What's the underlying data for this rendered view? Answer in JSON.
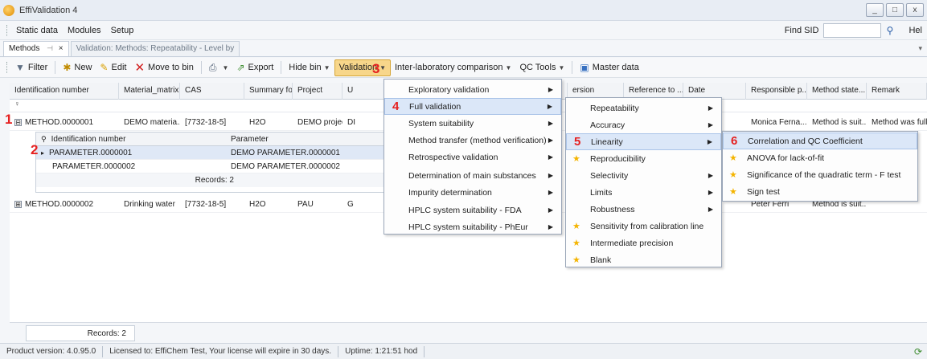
{
  "window": {
    "title": "EffiValidation 4",
    "min": "_",
    "max": "□",
    "close": "x"
  },
  "menubar": {
    "items": [
      "Static data",
      "Modules",
      "Setup"
    ],
    "find_label": "Find SID",
    "find_value": "",
    "help": "Hel"
  },
  "tabs": [
    {
      "label": "Methods",
      "pin": "⊣",
      "close": "×"
    },
    {
      "label": "Validation: Methods: Repeatability - Level by"
    }
  ],
  "toolbar": {
    "filter": "Filter",
    "new": "New",
    "edit": "Edit",
    "move_to_bin": "Move to bin",
    "export": "Export",
    "hide_bin": "Hide bin",
    "validation": "Validation",
    "inter_lab": "Inter-laboratory comparison",
    "qc_tools": "QC Tools",
    "master_data": "Master data"
  },
  "grid": {
    "headers": [
      "Identification number",
      "Material_matrix",
      "CAS",
      "Summary for...",
      "Project",
      "U",
      "ersion",
      "Reference to ...",
      "Date",
      "Responsible p...",
      "Method state...",
      "Remark"
    ],
    "rows": [
      {
        "id": "METHOD.0000001",
        "material": "DEMO materia...",
        "cas": "[7732-18-5]",
        "summary": "H2O",
        "project": "DEMO project",
        "u": "DI",
        "responsible": "Monica Ferna...",
        "state": "Method is suit...",
        "remark": "Method was full...",
        "expand": "⊟"
      },
      {
        "id": "METHOD.0000002",
        "material": "Drinking water",
        "cas": "[7732-18-5]",
        "summary": "H2O",
        "project": "PAU",
        "u": "G",
        "responsible": "Peter Ferri",
        "state": "Method is suit...",
        "remark": "",
        "expand": "⊞"
      }
    ],
    "detail": {
      "headers": [
        "Identification number",
        "Parameter"
      ],
      "rows": [
        {
          "id": "PARAMETER.0000001",
          "param": "DEMO PARAMETER.0000001"
        },
        {
          "id": "PARAMETER.0000002",
          "param": "DEMO PARAMETER.0000002"
        }
      ],
      "records": "Records: 2"
    },
    "records": "Records: 2"
  },
  "validation_menu": [
    "Exploratory validation",
    "Full validation",
    "System suitability",
    "Method transfer (method verification)",
    "Retrospective validation",
    "Determination of main substances",
    "Impurity determination",
    "HPLC system suitability - FDA",
    "HPLC system suitability - PhEur"
  ],
  "full_validation_menu": [
    "Repeatability",
    "Accuracy",
    "Linearity",
    "Reproducibility",
    "Selectivity",
    "Limits",
    "Robustness",
    "Sensitivity from calibration line",
    "Intermediate precision",
    "Blank"
  ],
  "linearity_menu": [
    "Correlation and QC Coefficient",
    "ANOVA for lack-of-fit",
    "Significance of the quadratic term - F test",
    "Sign test"
  ],
  "markers": [
    "1",
    "2",
    "3",
    "4",
    "5",
    "6"
  ],
  "status": {
    "version": "Product version: 4.0.95.0",
    "license": "Licensed to: EffiChem Test, Your license will expire in 30 days.",
    "uptime": "Uptime: 1:21:51 hod"
  }
}
